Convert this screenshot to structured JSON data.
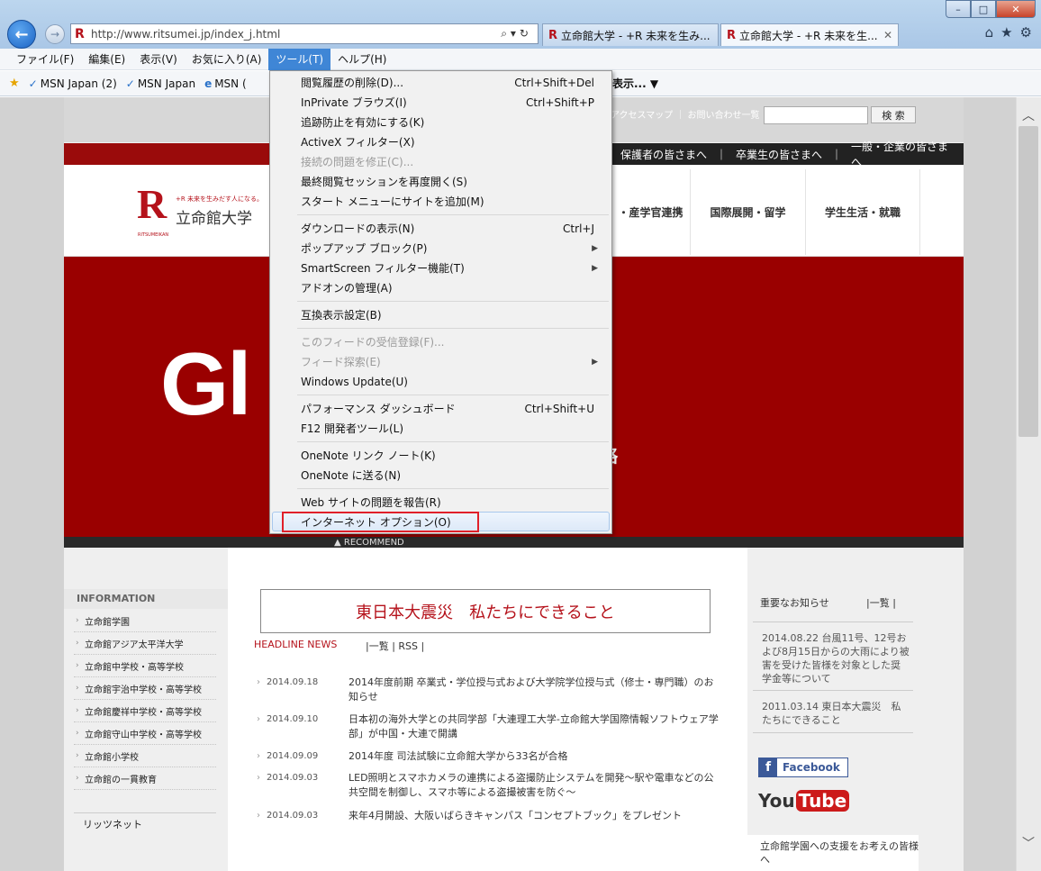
{
  "browser": {
    "url": "http://www.ritsumei.jp/index_j.html",
    "tabs": [
      {
        "label": "立命館大学 - +R 未来を生み..."
      },
      {
        "label": "立命館大学 - +R 未来を生..."
      }
    ],
    "window_controls": {
      "minimize": "–",
      "maximize": "□",
      "close": "✕"
    }
  },
  "menubar": {
    "items": [
      "ファイル(F)",
      "編集(E)",
      "表示(V)",
      "お気に入り(A)",
      "ツール(T)",
      "ヘルプ(H)"
    ]
  },
  "favorites": {
    "items": [
      "MSN Japan (2)",
      "MSN Japan",
      "MSN ("
    ],
    "overflow": "表示...  ▼"
  },
  "tools_menu": {
    "items": [
      {
        "label": "閲覧履歴の削除(D)...",
        "shortcut": "Ctrl+Shift+Del"
      },
      {
        "label": "InPrivate ブラウズ(I)",
        "shortcut": "Ctrl+Shift+P"
      },
      {
        "label": "追跡防止を有効にする(K)",
        "shortcut": ""
      },
      {
        "label": "ActiveX フィルター(X)",
        "shortcut": ""
      },
      {
        "label": "接続の問題を修正(C)...",
        "shortcut": ""
      },
      {
        "label": "最終閲覧セッションを再度開く(S)",
        "shortcut": ""
      },
      {
        "label": "スタート メニューにサイトを追加(M)",
        "shortcut": ""
      },
      {
        "label": "ダウンロードの表示(N)",
        "shortcut": "Ctrl+J"
      },
      {
        "label": "ポップアップ ブロック(P)",
        "shortcut": ""
      },
      {
        "label": "SmartScreen フィルター機能(T)",
        "shortcut": ""
      },
      {
        "label": "アドオンの管理(A)",
        "shortcut": ""
      },
      {
        "label": "互換表示設定(B)",
        "shortcut": ""
      },
      {
        "label": "このフィードの受信登録(F)...",
        "shortcut": ""
      },
      {
        "label": "フィード探索(E)",
        "shortcut": ""
      },
      {
        "label": "Windows Update(U)",
        "shortcut": ""
      },
      {
        "label": "パフォーマンス ダッシュボード",
        "shortcut": "Ctrl+Shift+U"
      },
      {
        "label": "F12 開発者ツール(L)",
        "shortcut": ""
      },
      {
        "label": "OneNote リンク ノート(K)",
        "shortcut": ""
      },
      {
        "label": "OneNote に送る(N)",
        "shortcut": ""
      },
      {
        "label": "Web サイトの問題を報告(R)",
        "shortcut": ""
      },
      {
        "label": "インターネット オプション(O)",
        "shortcut": ""
      }
    ]
  },
  "site": {
    "util_links": "アクセスマップ ｜ お問い合わせ一覧",
    "search_button": "検 索",
    "audience": [
      "保護者の皆さまへ",
      "｜",
      "卒業生の皆さまへ",
      "｜",
      "一般・企業の皆さまへ"
    ],
    "logo": {
      "r": "R",
      "slogan": "+R 未来を生みだす人になる。",
      "name": "立命館大学",
      "en": "RITSUMEIKAN"
    },
    "nav": [
      "・産学官連携",
      "国際展開・留学",
      "学生生活・就職"
    ],
    "hero_text": "Gl        riative",
    "hero_sub": "略",
    "recommend": "▲ RECOMMEND",
    "info_head": "INFORMATION",
    "info_items": [
      "立命館学園",
      "立命館アジア太平洋大学",
      "立命館中学校・高等学校",
      "立命館宇治中学校・高等学校",
      "立命館慶祥中学校・高等学校",
      "立命館守山中学校・高等学校",
      "立命館小学校",
      "立命館の一貫教育"
    ],
    "rits_net": "リッツネット",
    "quake_banner": "東日本大震災　私たちにできること",
    "headline_title": "HEADLINE NEWS",
    "headline_links": "|一覧 | RSS |",
    "news": [
      {
        "date": "2014.09.18",
        "text": "2014年度前期 卒業式・学位授与式および大学院学位授与式（修士・専門職）のお知らせ"
      },
      {
        "date": "2014.09.10",
        "text": "日本初の海外大学との共同学部「大連理工大学-立命館大学国際情報ソフトウェア学部」が中国・大連で開講"
      },
      {
        "date": "2014.09.09",
        "text": "2014年度 司法試験に立命館大学から33名が合格"
      },
      {
        "date": "2014.09.03",
        "text": "LED照明とスマホカメラの連携による盗撮防止システムを開発～駅や電車などの公共空間を制御し、スマホ等による盗撮被害を防ぐ～"
      },
      {
        "date": "2014.09.03",
        "text": "来年4月開設、大阪いばらきキャンパス「コンセプトブック」をプレゼント"
      }
    ],
    "notice_head": "重要なお知らせ",
    "notice_list": "|一覧 |",
    "notices": [
      "2014.08.22 台風11号、12号および8月15日からの大雨により被害を受けた皆様を対象とした奨学金等について",
      "2011.03.14 東日本大震災　私たちにできること"
    ],
    "facebook": "Facebook",
    "youtube_you": "You",
    "youtube_tube": "Tube",
    "support": "立命館学園への支援をお考えの皆様へ"
  }
}
